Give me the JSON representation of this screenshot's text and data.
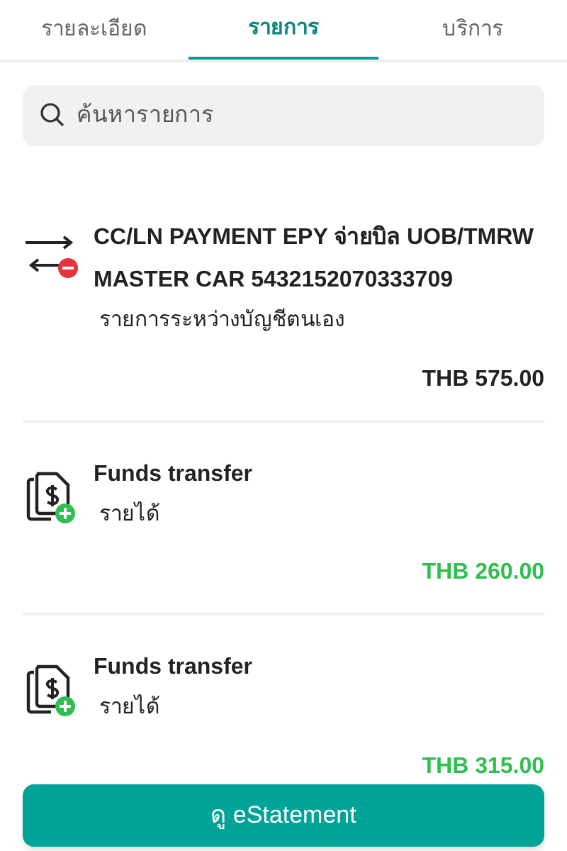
{
  "tabs": [
    {
      "label": "รายละเอียด",
      "selected": false
    },
    {
      "label": "รายการ",
      "selected": true
    },
    {
      "label": "บริการ",
      "selected": false
    }
  ],
  "search": {
    "placeholder": "ค้นหารายการ"
  },
  "transactions": [
    {
      "kind": "transfer",
      "title": "CC/LN PAYMENT EPY จ่ายบิล UOB/TMRW MASTER CAR 5432152070333709",
      "subtitle": "รายการระหว่างบัญชีตนเอง",
      "amount": "THB 575.00"
    },
    {
      "kind": "income",
      "title": "Funds transfer",
      "subtitle": "รายได้",
      "amount": "THB 260.00"
    },
    {
      "kind": "income",
      "title": "Funds transfer",
      "subtitle": "รายได้",
      "amount": "THB 315.00"
    }
  ],
  "button": "ดู eStatement"
}
